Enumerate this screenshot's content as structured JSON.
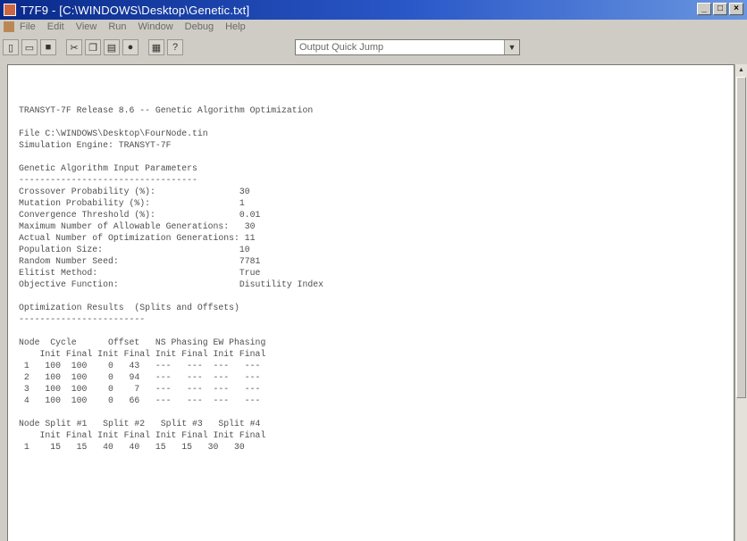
{
  "window": {
    "title": "T7F9 - [C:\\WINDOWS\\Desktop\\Genetic.txt]",
    "controls": [
      "_",
      "□",
      "×"
    ]
  },
  "menu": {
    "items": [
      "File",
      "Edit",
      "View",
      "Run",
      "Window",
      "Debug",
      "Help"
    ]
  },
  "toolbar": {
    "quick_jump_value": "Output Quick Jump"
  },
  "doc": {
    "lines": [
      "TRANSYT-7F Release 8.6 -- Genetic Algorithm Optimization",
      "",
      "File C:\\WINDOWS\\Desktop\\FourNode.tin",
      "Simulation Engine: TRANSYT-7F",
      "",
      "Genetic Algorithm Input Parameters",
      "----------------------------------",
      "Crossover Probability (%):                30",
      "Mutation Probability (%):                 1",
      "Convergence Threshold (%):                0.01",
      "Maximum Number of Allowable Generations:   30",
      "Actual Number of Optimization Generations: 11",
      "Population Size:                          10",
      "Random Number Seed:                       7781",
      "Elitist Method:                           True",
      "Objective Function:                       Disutility Index",
      "",
      "Optimization Results  (Splits and Offsets)",
      "------------------------",
      "",
      "Node  Cycle      Offset   NS Phasing EW Phasing",
      "    Init Final Init Final Init Final Init Final",
      " 1   100  100    0   43   ---   ---  ---   ---",
      " 2   100  100    0   94   ---   ---  ---   ---",
      " 3   100  100    0    7   ---   ---  ---   ---",
      " 4   100  100    0   66   ---   ---  ---   ---",
      "",
      "Node Split #1   Split #2   Split #3   Split #4",
      "    Init Final Init Final Init Final Init Final",
      " 1    15   15   40   40   15   15   30   30"
    ]
  }
}
